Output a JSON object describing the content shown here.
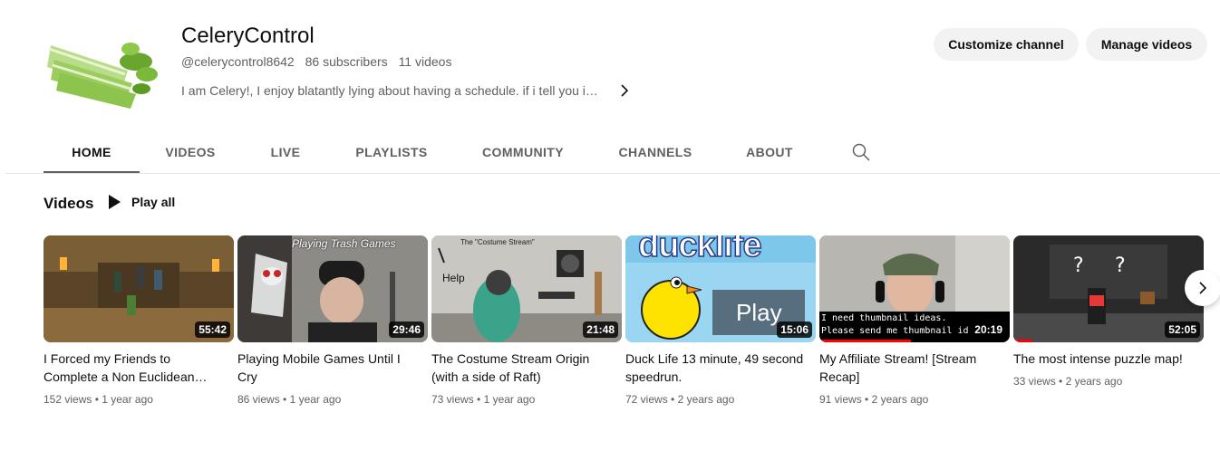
{
  "channel": {
    "name": "CeleryControl",
    "handle": "@celerycontrol8642",
    "subscribers": "86 subscribers",
    "video_count": "11 videos",
    "description": "I am Celery!, I enjoy blatantly lying about having a schedule. if i tell you im ...",
    "avatar_icon": "celery-avatar"
  },
  "actions": {
    "customize": "Customize channel",
    "manage": "Manage videos"
  },
  "tabs": [
    {
      "label": "HOME",
      "active": true
    },
    {
      "label": "VIDEOS",
      "active": false
    },
    {
      "label": "LIVE",
      "active": false
    },
    {
      "label": "PLAYLISTS",
      "active": false
    },
    {
      "label": "COMMUNITY",
      "active": false
    },
    {
      "label": "CHANNELS",
      "active": false
    },
    {
      "label": "ABOUT",
      "active": false
    }
  ],
  "section": {
    "title": "Videos",
    "play_all": "Play all"
  },
  "videos": [
    {
      "title": "I Forced my Friends to Complete a Non Euclidean Maze",
      "duration": "55:42",
      "views": "152 views",
      "age": "1 year ago",
      "watched": 0.0
    },
    {
      "title": "Playing Mobile Games Until I Cry",
      "duration": "29:46",
      "views": "86 views",
      "age": "1 year ago",
      "watched": 0.0,
      "thumb_text": "Playing Trash Games"
    },
    {
      "title": "The Costume Stream Origin (with a side of Raft)",
      "duration": "21:48",
      "views": "73 views",
      "age": "1 year ago",
      "watched": 0.0,
      "thumb_text": "The \"Costume Stream\"",
      "thumb_text2": "Help"
    },
    {
      "title": "Duck Life 13 minute, 49 second speedrun.",
      "duration": "15:06",
      "views": "72 views",
      "age": "2 years ago",
      "watched": 0.0,
      "thumb_text": "ducklife",
      "thumb_text2": "Play"
    },
    {
      "title": "My Affiliate Stream! [Stream Recap]",
      "duration": "20:19",
      "views": "91 views",
      "age": "2 years ago",
      "watched": 0.48,
      "thumb_text": "I need thumbnail ideas.",
      "thumb_text2": "Please send me thumbnail id"
    },
    {
      "title": "The most intense puzzle map!",
      "duration": "52:05",
      "views": "33 views",
      "age": "2 years ago",
      "watched": 0.1
    }
  ],
  "colors": {
    "progress": "#ff0000",
    "pill_bg": "#f2f2f2",
    "muted_text": "#606060"
  }
}
